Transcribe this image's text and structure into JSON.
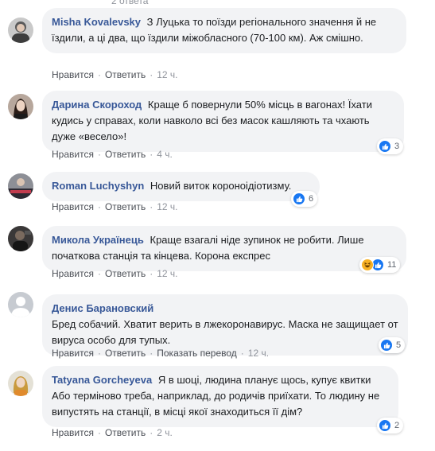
{
  "top_fragment": "2 ответа",
  "actions": {
    "like_label": "Нравится",
    "reply_label": "Ответить",
    "translate_label": "Показать перевод",
    "separator": "·"
  },
  "comments": [
    {
      "author": "Misha Kovalevsky",
      "text": "З Луцька то поїзди регіонального значення й не їздили, а ці два, що їздили міжобласного (70-100 км). Аж смішно.",
      "time": "12 ч.",
      "reactions": null
    },
    {
      "author": "Дарина Скороход",
      "text": "Краще б повернули 50% місць в вагонах! Їхати кудись у справах, коли навколо всі без масок кашляють та чхають дуже «весело»!",
      "time": "4 ч.",
      "reactions": {
        "icons": [
          "like-icon"
        ],
        "count": "3"
      }
    },
    {
      "author": "Roman Luchyshyn",
      "text": "Новий виток короноідіотизму.",
      "time": "12 ч.",
      "reactions": {
        "icons": [
          "like-icon"
        ],
        "count": "6"
      }
    },
    {
      "author": "Микола Українець",
      "text": "Краще взагалі ніде зупинок не робити. Лише початкова станція та кінцева. Корона експрес",
      "time": "12 ч.",
      "reactions": {
        "icons": [
          "haha-icon",
          "like-icon"
        ],
        "count": "11"
      }
    },
    {
      "author": "Денис Барановский",
      "text": "Бред собачий. Хватит верить в лжекоронавирус. Маска не защищает от вируса особо для тупых.",
      "time": "12 ч.",
      "show_translation": true,
      "reactions": {
        "icons": [
          "like-icon"
        ],
        "count": "5"
      }
    },
    {
      "author": "Tatyana Gorcheyeva",
      "text": "Я в шоці, людина планує щось, купує квитки Або терміново треба, наприклад, до родичів приїхати. То людину не випустять на станції, в місці якої знаходиться її дім?",
      "time": "2 ч.",
      "reactions": {
        "icons": [
          "like-icon"
        ],
        "count": "2"
      }
    }
  ]
}
